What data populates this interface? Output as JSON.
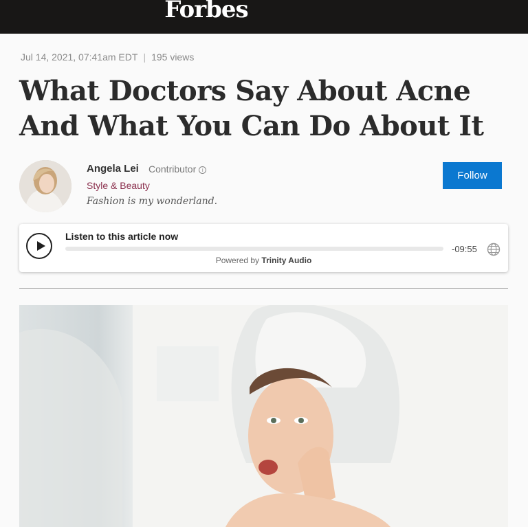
{
  "header": {
    "logo": "Forbes"
  },
  "article": {
    "date": "Jul 14, 2021, 07:41am EDT",
    "separator": "|",
    "views": "195 views",
    "headline": "What Doctors Say About Acne And What You Can Do About It"
  },
  "author": {
    "name": "Angela Lei",
    "role": "Contributor",
    "category": "Style & Beauty",
    "bio": "Fashion is my wonderland.",
    "follow_label": "Follow"
  },
  "audio_player": {
    "title": "Listen to this article now",
    "time_remaining": "-09:55",
    "progress": 0,
    "powered_by_prefix": "Powered by",
    "powered_by_brand": "Trinity Audio"
  },
  "colors": {
    "header_bg": "#181716",
    "follow_button": "#0b78d0",
    "category_text": "#8a2e4c"
  }
}
